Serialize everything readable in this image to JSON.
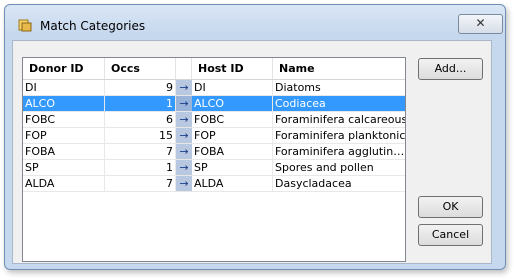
{
  "window": {
    "title": "Match Categories",
    "close_glyph": "✕"
  },
  "table": {
    "headers": {
      "donor_id": "Donor ID",
      "occs": "Occs",
      "host_id": "Host ID",
      "name": "Name"
    },
    "selected_row": 1,
    "rows": [
      {
        "donor_id": "DI",
        "occs": "9",
        "host_id": "DI",
        "name": "Diatoms"
      },
      {
        "donor_id": "ALCO",
        "occs": "1",
        "host_id": "ALCO",
        "name": "Codiacea"
      },
      {
        "donor_id": "FOBC",
        "occs": "6",
        "host_id": "FOBC",
        "name": "Foraminifera calcareous"
      },
      {
        "donor_id": "FOP",
        "occs": "15",
        "host_id": "FOP",
        "name": "Foraminifera planktonic"
      },
      {
        "donor_id": "FOBA",
        "occs": "7",
        "host_id": "FOBA",
        "name": "Foraminifera agglutin…"
      },
      {
        "donor_id": "SP",
        "occs": "1",
        "host_id": "SP",
        "name": "Spores and pollen"
      },
      {
        "donor_id": "ALDA",
        "occs": "7",
        "host_id": "ALDA",
        "name": "Dasycladacea"
      }
    ],
    "arrow_glyph": "→"
  },
  "buttons": {
    "add": "Add...",
    "ok": "OK",
    "cancel": "Cancel"
  },
  "icons": {
    "app": "app-icon",
    "close": "close-icon",
    "arrow": "arrow-right-icon"
  },
  "colors": {
    "selection": "#3399ff",
    "titlebar": "#c6d8ee"
  }
}
